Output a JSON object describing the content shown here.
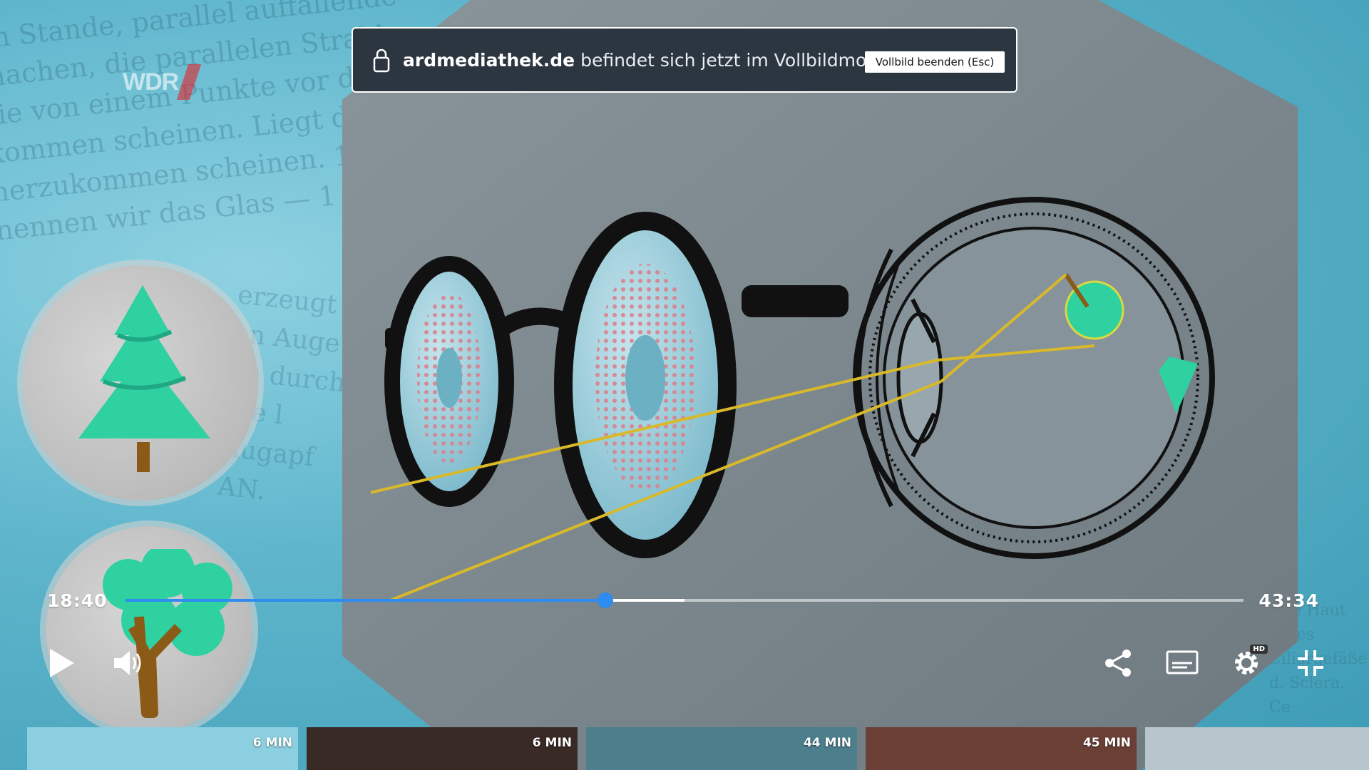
{
  "background_text": {
    "lines": [
      "im Stande, parallel auffallende",
      "machen, die parallelen Strahlen",
      "sie von einem Punkte vor dem Glase",
      "kommen scheinen. Liegt dieser",
      "herzukommen scheinen. 1",
      "nennen wir das Glas — 1"
    ],
    "lines_right": [
      "erzeugt",
      "en Auge",
      "en durch",
      "Sie l",
      "Augapf",
      "AN."
    ],
    "lines_far_right": [
      "tere Haut",
      "D des",
      "Ciliargefäße",
      "d. Sclera. Ce"
    ]
  },
  "channel_logo": {
    "text": "WDR"
  },
  "fullscreen_notice": {
    "domain": "ardmediathek.de",
    "message": " befindet sich jetzt im Vollbildmodus.",
    "exit_label": "Vollbild beenden (Esc)"
  },
  "player": {
    "current_time": "18:40",
    "duration": "43:34",
    "progress": 0.429,
    "buffered": 0.5,
    "hd_badge": "HD"
  },
  "thumbnails": [
    {
      "duration": "6 MIN",
      "color": "#8ccfe0"
    },
    {
      "duration": "6 MIN",
      "color": "#3a2a26"
    },
    {
      "duration": "44 MIN",
      "color": "#4c7e8c"
    },
    {
      "duration": "45 MIN",
      "color": "#6a4036"
    },
    {
      "duration": "",
      "color": "#b7c5cc"
    }
  ],
  "colors": {
    "accent": "#2e8bf0",
    "illustration_panel": "#7d8a90",
    "ray_color": "#d9b92a",
    "tree_color": "#2fd1a0"
  }
}
